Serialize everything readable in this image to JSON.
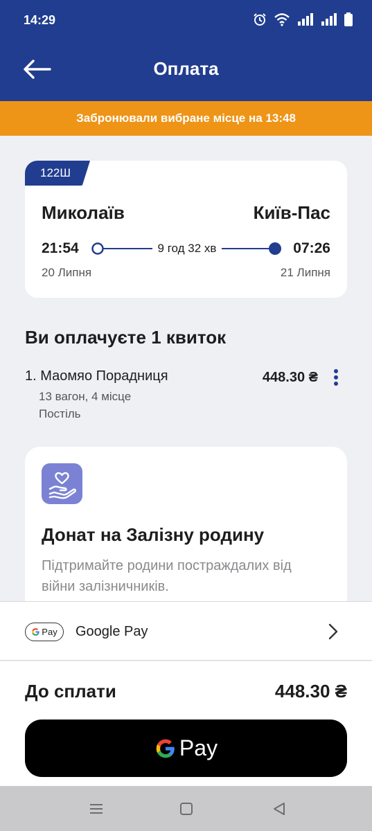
{
  "status_bar": {
    "time": "14:29"
  },
  "header": {
    "title": "Оплата"
  },
  "banner": {
    "text": "Забронювали вибране місце на 13:48"
  },
  "trip": {
    "train_number": "122Ш",
    "from_city": "Миколаїв",
    "to_city": "Київ-Пас",
    "departure_time": "21:54",
    "arrival_time": "07:26",
    "duration": "9 год 32 хв",
    "departure_date": "20 Липня",
    "arrival_date": "21 Липня"
  },
  "tickets": {
    "title": "Ви оплачуєте 1 квиток",
    "items": [
      {
        "name": "1. Маомяо Порадниця",
        "details_line1": "13 вагон, 4 місце",
        "details_line2": "Постіль",
        "price": "448.30 ₴"
      }
    ]
  },
  "donate": {
    "icon": "heart-hand-icon",
    "title": "Донат на Залізну родину",
    "text": "Підтримайте родини постраждалих від війни залізничників."
  },
  "payment_method": {
    "badge": "Pay",
    "label": "Google Pay"
  },
  "total": {
    "label": "До сплати",
    "value": "448.30 ₴"
  },
  "pay_button": {
    "label": "Pay"
  },
  "colors": {
    "primary": "#213d8f",
    "banner": "#ee9417",
    "donate_icon_bg": "#7b82d4"
  }
}
